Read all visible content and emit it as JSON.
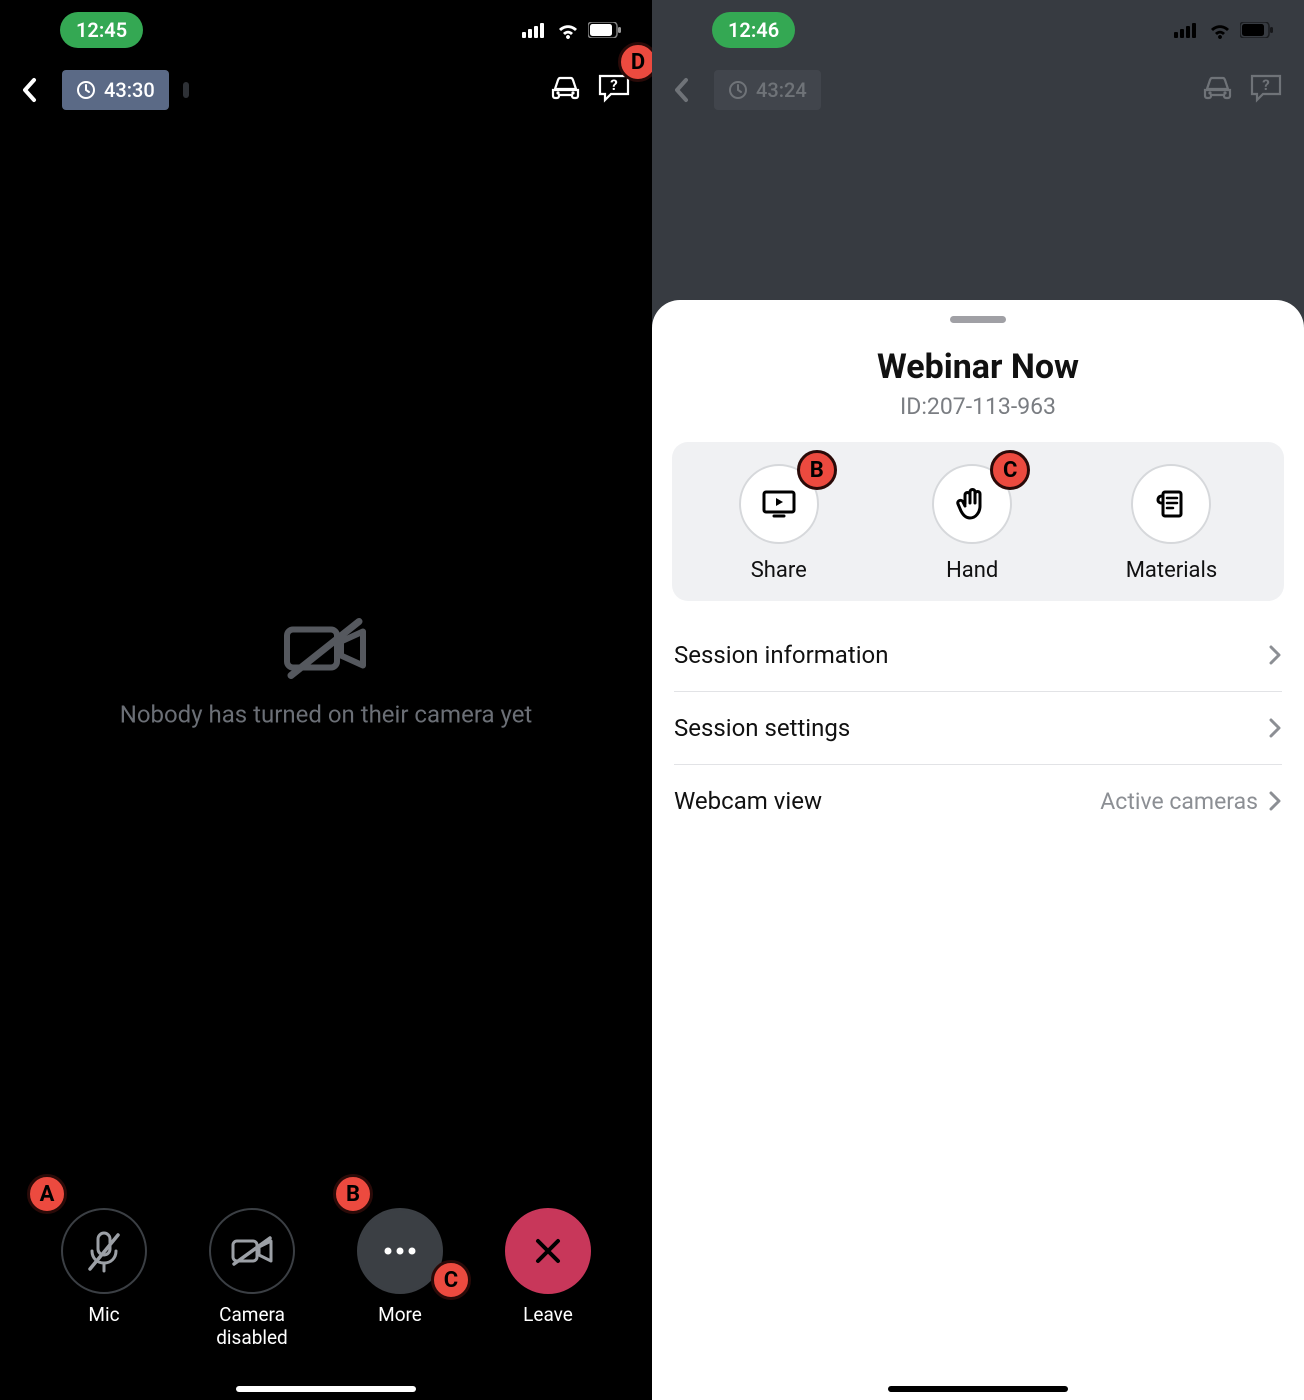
{
  "left": {
    "status": {
      "time": "12:45"
    },
    "nav": {
      "timer": "43:30"
    },
    "empty": {
      "message": "Nobody has turned on their camera yet"
    },
    "controls": {
      "mic": "Mic",
      "camera": "Camera\ndisabled",
      "more": "More",
      "leave": "Leave"
    },
    "markers": {
      "a": "A",
      "b": "B",
      "c": "C",
      "d": "D"
    }
  },
  "right": {
    "status": {
      "time": "12:46"
    },
    "nav": {
      "timer": "43:24"
    },
    "sheet": {
      "title": "Webinar Now",
      "id_label": "ID:207-113-963",
      "actions": {
        "share": "Share",
        "hand": "Hand",
        "materials": "Materials"
      },
      "menu": {
        "info": "Session information",
        "settings": "Session settings",
        "webcam_title": "Webcam view",
        "webcam_value": "Active cameras"
      },
      "markers": {
        "b": "B",
        "c": "C"
      }
    }
  }
}
